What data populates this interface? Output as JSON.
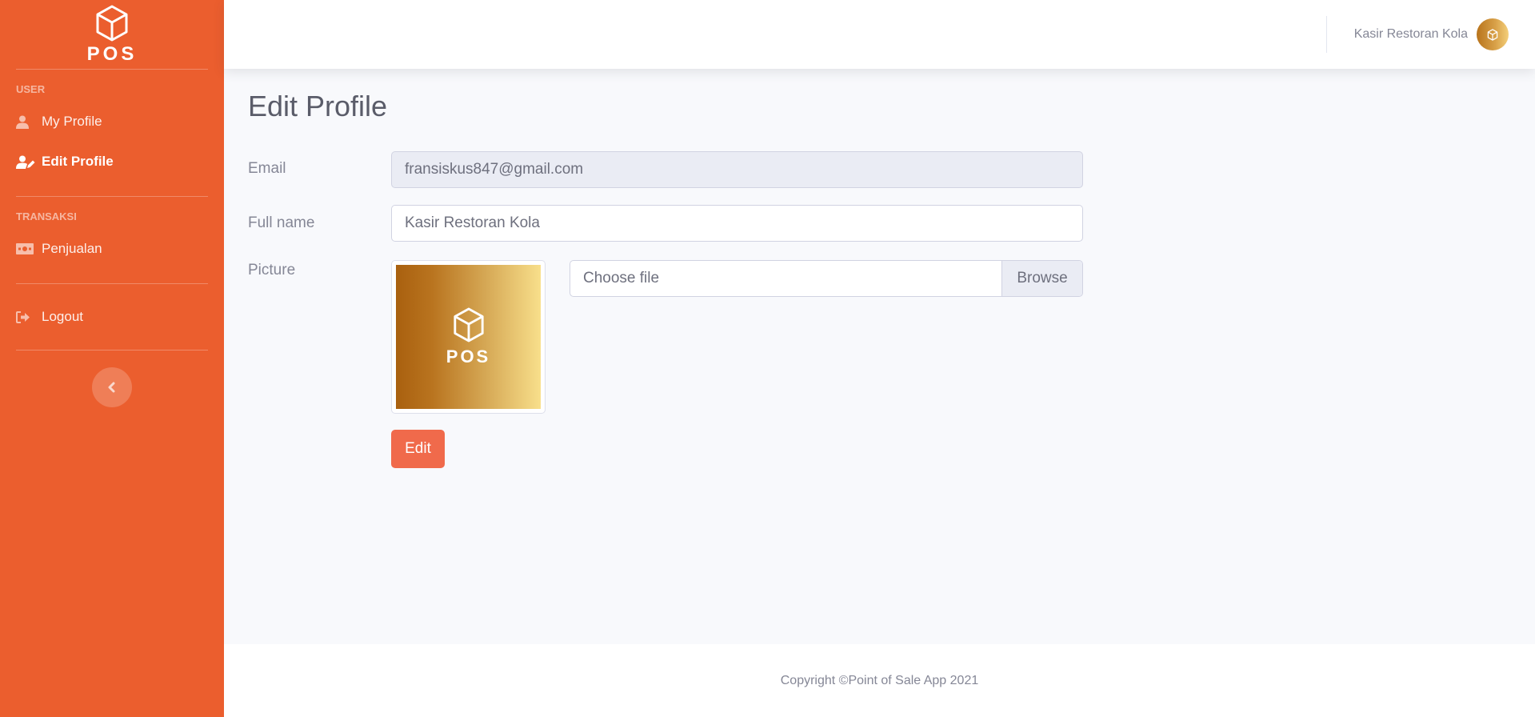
{
  "app": {
    "brand": "POS"
  },
  "sidebar": {
    "sections": [
      {
        "heading": "USER",
        "items": [
          {
            "label": "My Profile",
            "icon": "user-icon",
            "active": false
          },
          {
            "label": "Edit Profile",
            "icon": "user-edit-icon",
            "active": true
          }
        ]
      },
      {
        "heading": "TRANSAKSI",
        "items": [
          {
            "label": "Penjualan",
            "icon": "money-bill-icon",
            "active": false
          }
        ]
      }
    ],
    "logout_label": "Logout",
    "toggle_icon": "chevron-left-icon"
  },
  "topbar": {
    "user_name": "Kasir Restoran Kola"
  },
  "page": {
    "title": "Edit Profile",
    "form": {
      "email_label": "Email",
      "email_value": "fransiskus847@gmail.com",
      "fullname_label": "Full name",
      "fullname_value": "Kasir Restoran Kola",
      "picture_label": "Picture",
      "picture_text": "POS",
      "file_placeholder": "Choose file",
      "browse_label": "Browse",
      "submit_label": "Edit"
    }
  },
  "footer": {
    "copyright": "Copyright ©Point of Sale App 2021"
  },
  "colors": {
    "sidebar_bg": "#eb5e2e",
    "button_bg": "#f06a4b",
    "page_bg": "#f8f9fc"
  }
}
